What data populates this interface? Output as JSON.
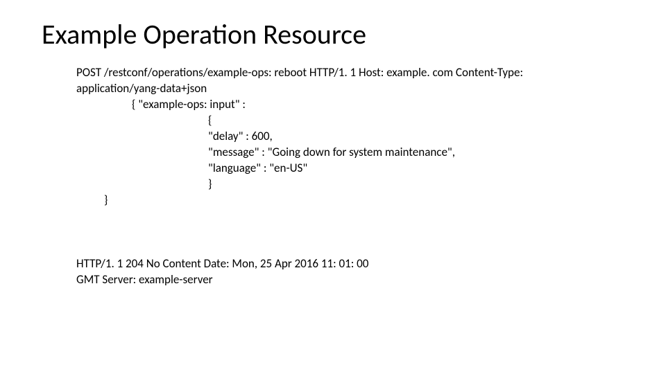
{
  "title": "Example Operation Resource",
  "request": {
    "line1": "POST /restconf/operations/example-ops: reboot HTTP/1. 1 Host: example. com Content-Type:",
    "line2": "application/yang-data+json",
    "json_open": "{ \"example-ops: input\" :",
    "brace_open": "{",
    "delay": "\"delay\" : 600,",
    "message": "\"message\" : \"Going down for system maintenance\",",
    "language": "\"language\" : \"en-US\"",
    "brace_close": "}",
    "json_close": "}"
  },
  "response": {
    "line1": "HTTP/1. 1 204 No Content Date: Mon, 25 Apr 2016 11: 01: 00",
    "line2": "GMT Server: example-server"
  }
}
